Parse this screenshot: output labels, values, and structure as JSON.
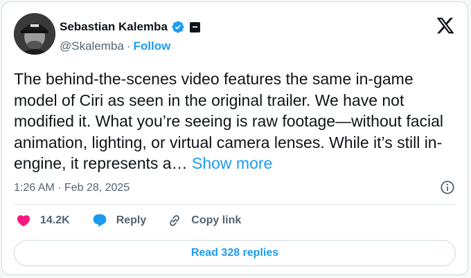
{
  "author": {
    "name": "Sebastian Kalemba",
    "handle": "@Skalemba",
    "separator": "·",
    "follow_label": "Follow"
  },
  "tweet": {
    "text": "The behind-the-scenes video features the same in-game model of Ciri as seen in the original trailer. We have not modified it. What you’re seeing is raw footage—without facial animation, lighting, or virtual camera lenses. While it’s still in-engine, it represents a…",
    "show_more_label": "Show more",
    "timestamp": "1:26 AM · Feb 28, 2025"
  },
  "actions": {
    "likes_count": "14.2K",
    "reply_label": "Reply",
    "copy_link_label": "Copy link"
  },
  "read_replies_label": "Read 328 replies",
  "colors": {
    "accent": "#1d9bf0",
    "like": "#f91880",
    "text": "#0f1419",
    "muted": "#536471",
    "border": "#cfd9de"
  },
  "icons": [
    "verified-badge-icon",
    "affiliate-badge-icon",
    "x-logo-icon",
    "info-icon",
    "heart-icon",
    "reply-icon",
    "link-icon"
  ]
}
